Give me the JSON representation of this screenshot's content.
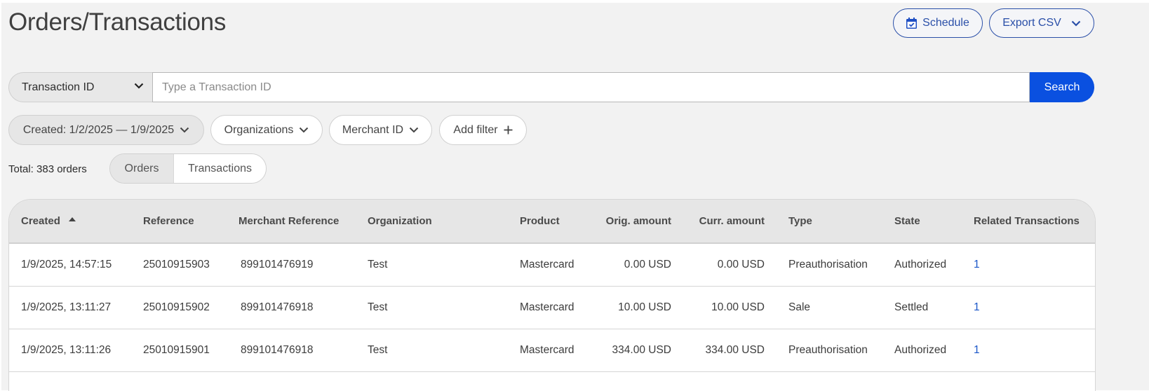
{
  "header": {
    "title": "Orders/Transactions",
    "schedule_label": "Schedule",
    "export_label": "Export CSV"
  },
  "search": {
    "type_selected": "Transaction ID",
    "placeholder": "Type a Transaction ID",
    "value": "",
    "button_label": "Search"
  },
  "filters": {
    "created": "Created: 1/2/2025 — 1/9/2025",
    "organizations": "Organizations",
    "merchant_id": "Merchant ID",
    "add_filter": "Add filter"
  },
  "summary": {
    "total": "Total: 383 orders"
  },
  "view_toggle": {
    "orders": "Orders",
    "transactions": "Transactions",
    "selected": "Orders"
  },
  "table": {
    "sort": {
      "column": "Created",
      "direction": "ascending"
    },
    "columns": [
      "Created",
      "Reference",
      "Merchant Reference",
      "Organization",
      "Product",
      "Orig. amount",
      "Curr. amount",
      "Type",
      "State",
      "Related Transactions"
    ],
    "rows": [
      [
        "1/9/2025, 14:57:15",
        "25010915903",
        "899101476919",
        "Test",
        "Mastercard",
        "0.00 USD",
        "0.00 USD",
        "Preauthorisation",
        "Authorized",
        "1"
      ],
      [
        "1/9/2025, 13:11:27",
        "25010915902",
        "899101476918",
        "Test",
        "Mastercard",
        "10.00 USD",
        "10.00 USD",
        "Sale",
        "Settled",
        "1"
      ],
      [
        "1/9/2025, 13:11:26",
        "25010915901",
        "899101476918",
        "Test",
        "Mastercard",
        "334.00 USD",
        "334.00 USD",
        "Preauthorisation",
        "Authorized",
        "1"
      ]
    ]
  },
  "colors": {
    "accent": "#0a50e0",
    "outline_button": "#2a4fa8",
    "link": "#1a56c8",
    "background": "#f2f2f2"
  }
}
